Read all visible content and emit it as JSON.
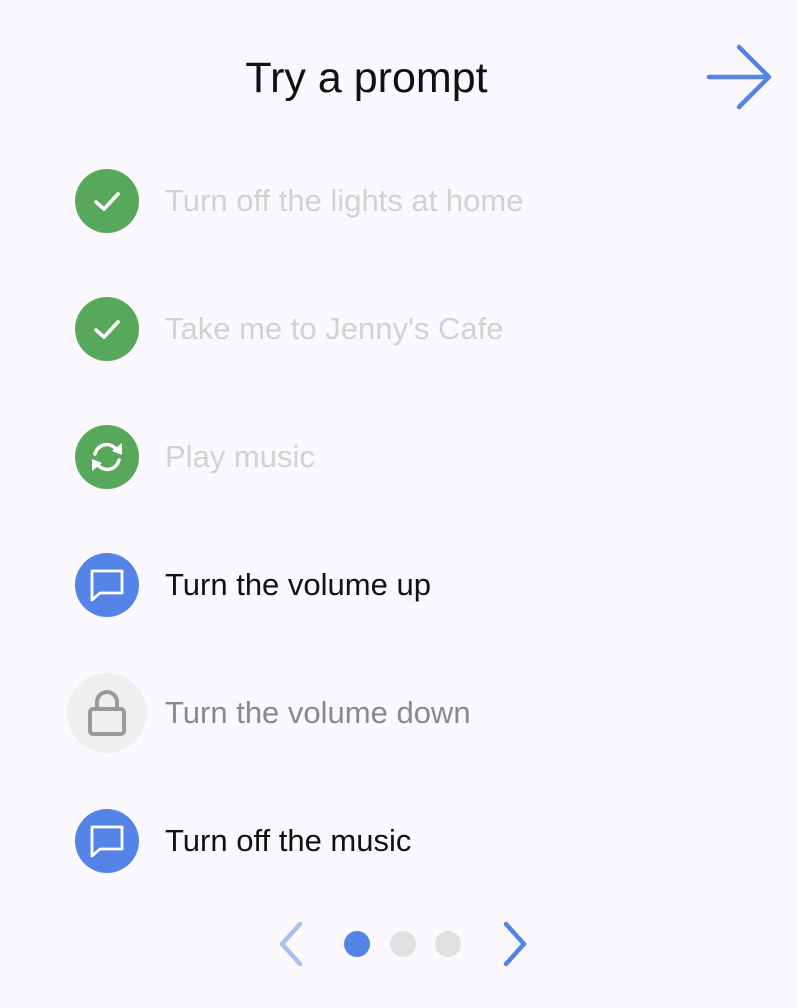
{
  "header": {
    "title": "Try a prompt",
    "next_icon": "arrow-right-icon"
  },
  "colors": {
    "background": "#fbf9fd",
    "accent_blue": "#5484e8",
    "success_green": "#58a85c",
    "locked_bg": "#efefef",
    "locked_icon": "#9a9a9a",
    "text_done": "#d2d2d2",
    "text_active": "#111111",
    "text_locked": "#8a8a8a",
    "dot_inactive": "#e1e1e1"
  },
  "prompts": [
    {
      "label": "Turn off the lights at home",
      "state": "completed",
      "icon": "check-icon"
    },
    {
      "label": "Take me to Jenny's Cafe",
      "state": "completed",
      "icon": "check-icon"
    },
    {
      "label": "Play music",
      "state": "completed",
      "icon": "refresh-icon"
    },
    {
      "label": "Turn the volume up",
      "state": "available",
      "icon": "chat-bubble-icon"
    },
    {
      "label": "Turn the volume down",
      "state": "locked",
      "icon": "lock-icon"
    },
    {
      "label": "Turn off the music",
      "state": "available",
      "icon": "chat-bubble-icon"
    }
  ],
  "pagination": {
    "page_count": 3,
    "current_page": 1,
    "prev_icon": "chevron-left-icon",
    "next_icon": "chevron-right-icon"
  }
}
